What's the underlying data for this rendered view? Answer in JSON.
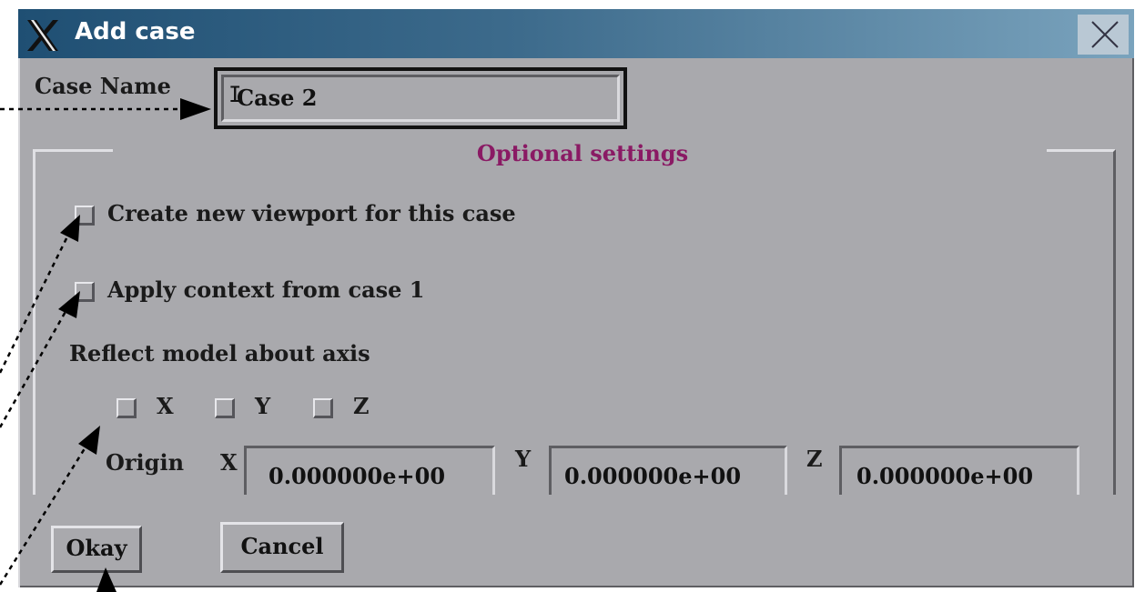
{
  "window": {
    "title": "Add case",
    "app_icon": "x-window-icon",
    "close_icon": "close-icon"
  },
  "case_name": {
    "label": "Case Name",
    "value": "Case 2"
  },
  "optional": {
    "title": "Optional settings",
    "create_viewport_label": "Create new viewport for this case",
    "apply_context_label": "Apply context from case 1",
    "reflect_label": "Reflect model about axis",
    "axes": [
      {
        "label": "X",
        "checked": false
      },
      {
        "label": "Y",
        "checked": false
      },
      {
        "label": "Z",
        "checked": false
      }
    ],
    "origin": {
      "label": "Origin",
      "x_label": "X",
      "x_value": "0.000000e+00",
      "y_label": "Y",
      "y_value": "0.000000e+00",
      "z_label": "Z",
      "z_value": "0.000000e+00"
    }
  },
  "buttons": {
    "okay": "Okay",
    "cancel": "Cancel"
  },
  "colors": {
    "dialog_bg": "#a9a9ad",
    "titlebar_start": "#1f4f73",
    "titlebar_end": "#7aa3bd",
    "group_title": "#8a1a64"
  }
}
